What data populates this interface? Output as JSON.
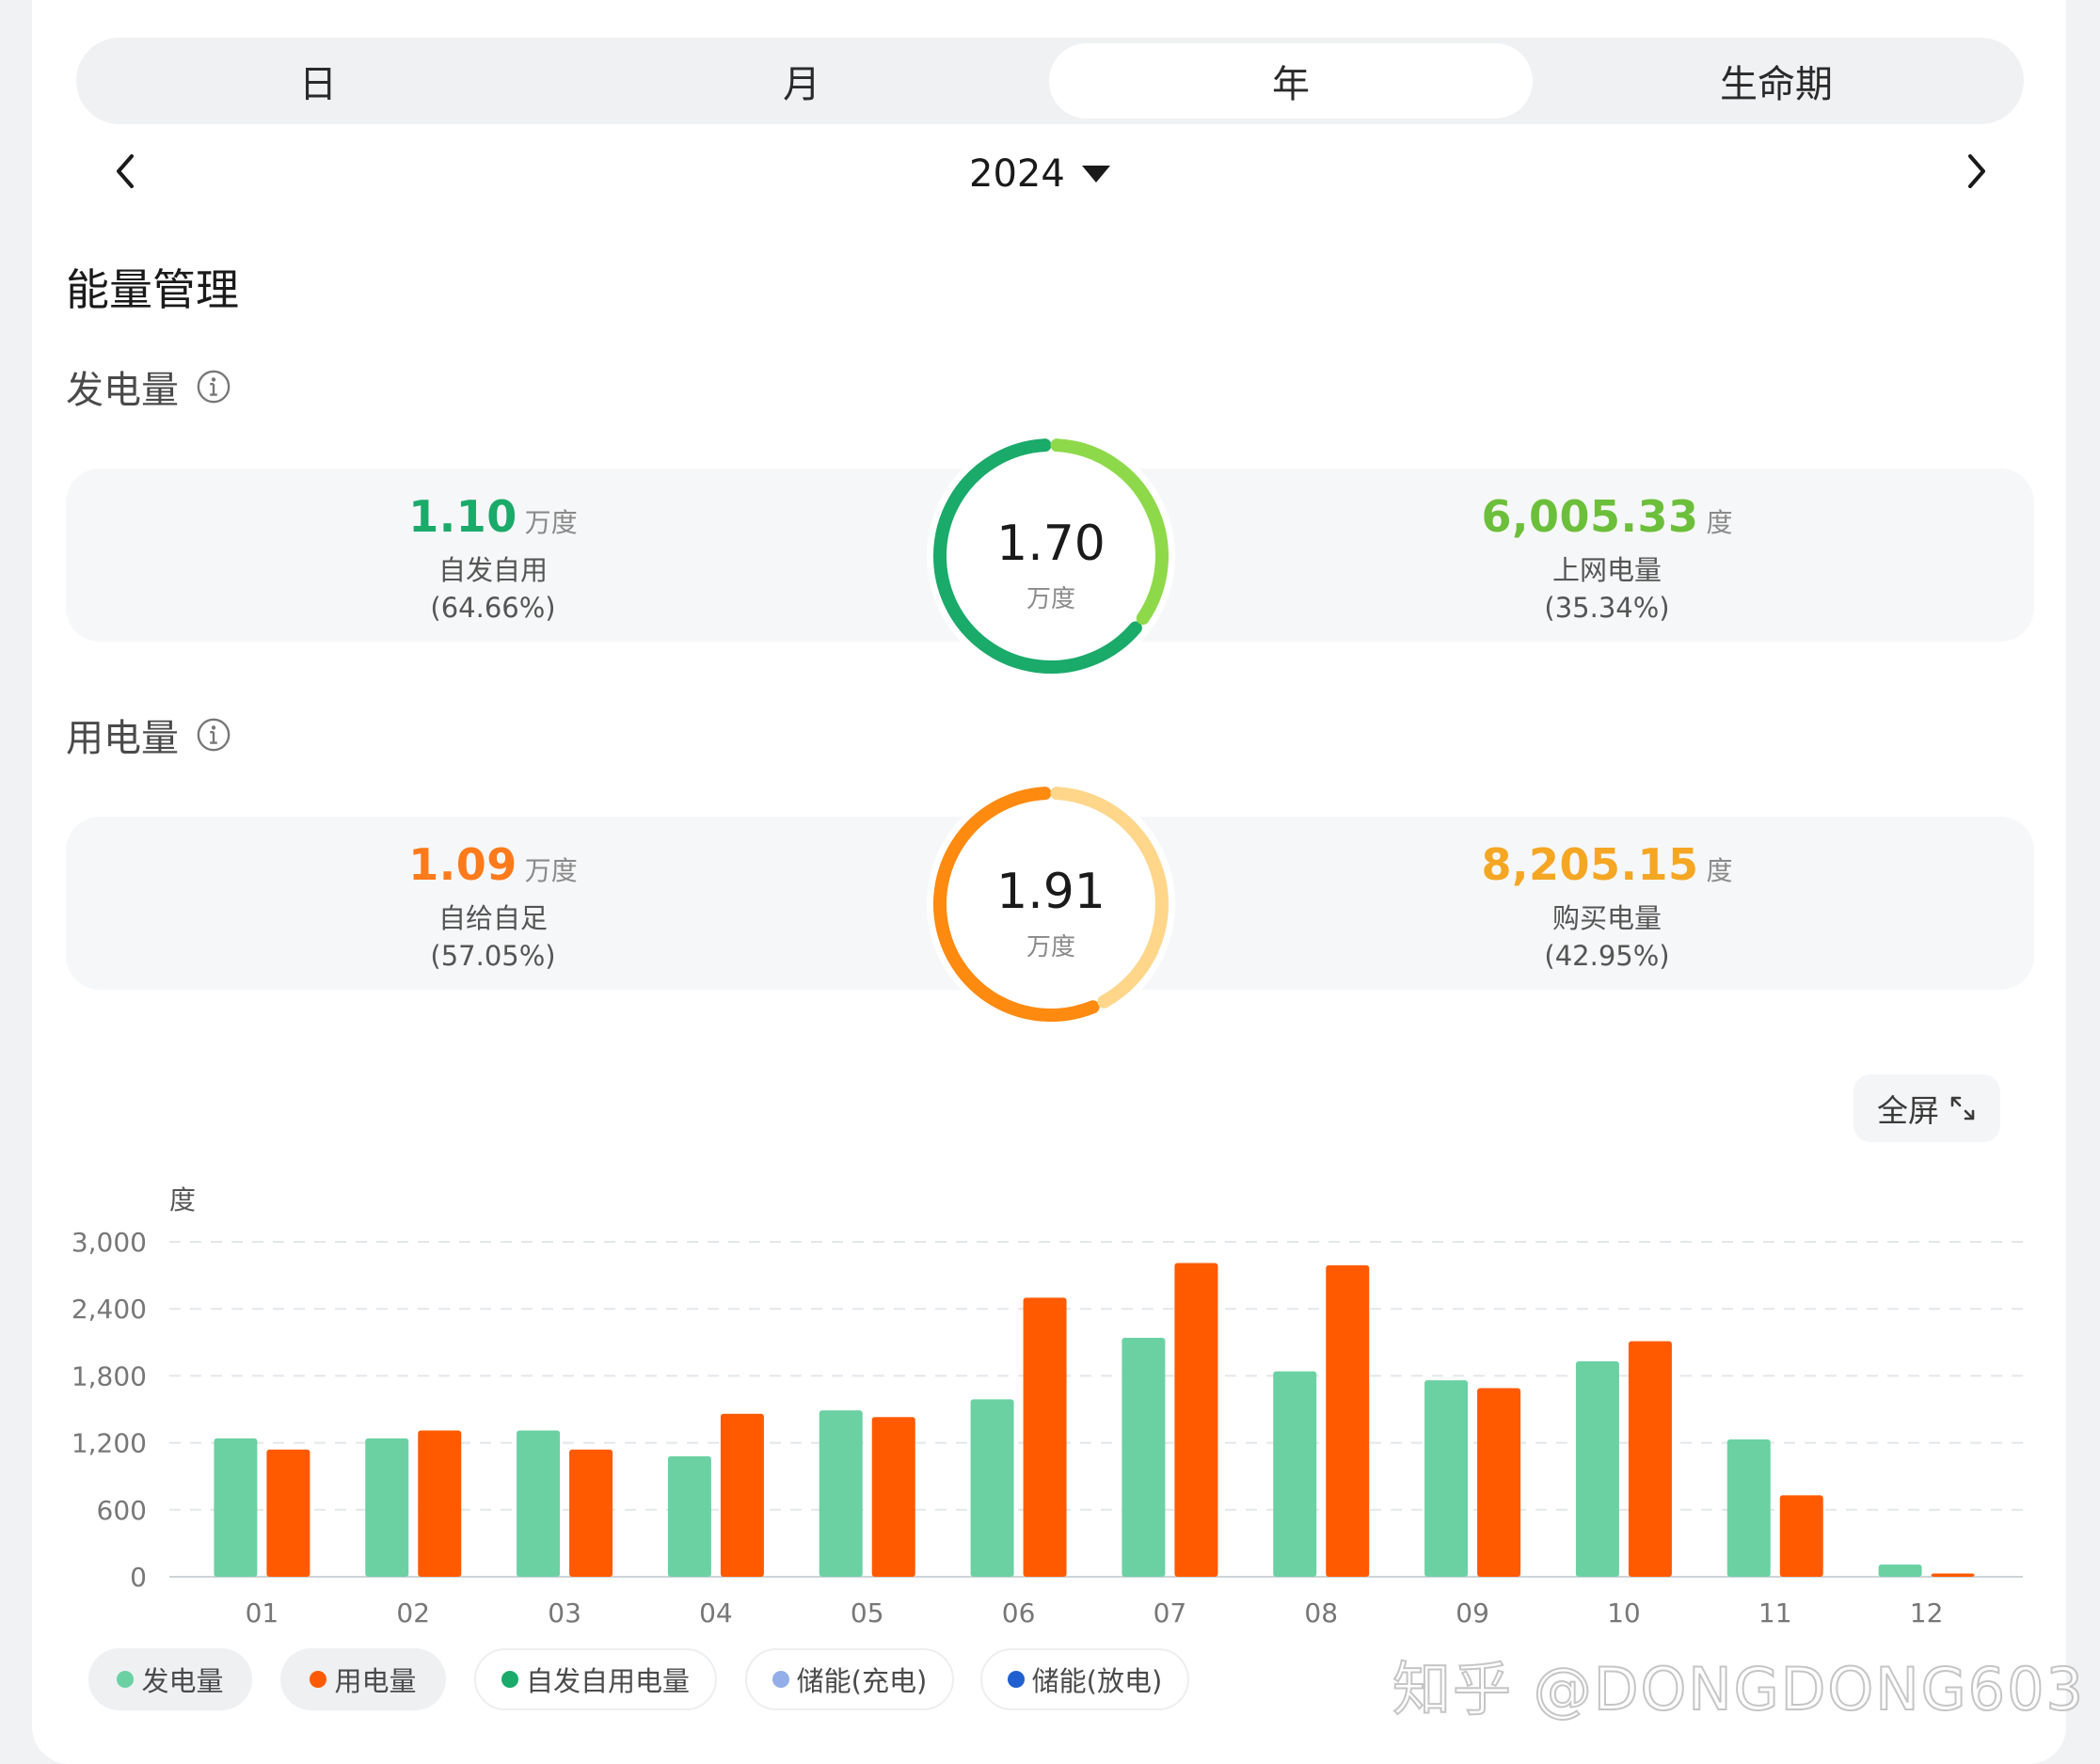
{
  "tabs": [
    {
      "label": "日",
      "active": false
    },
    {
      "label": "月",
      "active": false
    },
    {
      "label": "年",
      "active": true
    },
    {
      "label": "生命期",
      "active": false
    }
  ],
  "year_nav": {
    "year": "2024"
  },
  "section_title": "能量管理",
  "generation": {
    "heading": "发电量",
    "left": {
      "value": "1.10",
      "unit": "万度",
      "label": "自发自用",
      "pct": "(64.66%)",
      "color": "#1aaa6a"
    },
    "ring": {
      "value": "1.70",
      "unit": "万度",
      "share": 0.6466,
      "color_main": "#1aaa6a",
      "color_rest": "#8ed94a"
    },
    "right": {
      "value": "6,005.33",
      "unit": "度",
      "label": "上网电量",
      "pct": "(35.34%)",
      "color": "#6cbf3a"
    }
  },
  "consumption": {
    "heading": "用电量",
    "left": {
      "value": "1.09",
      "unit": "万度",
      "label": "自给自足",
      "pct": "(57.05%)",
      "color": "#ff7a1a"
    },
    "ring": {
      "value": "1.91",
      "unit": "万度",
      "share": 0.5705,
      "color_main": "#ff8a10",
      "color_rest": "#ffd68a"
    },
    "right": {
      "value": "8,205.15",
      "unit": "度",
      "label": "购买电量",
      "pct": "(42.95%)",
      "color": "#f5a623"
    }
  },
  "fullscreen_label": "全屏",
  "chart_data": {
    "type": "bar",
    "ylabel": "度",
    "ylim": [
      0,
      3000
    ],
    "yticks": [
      0,
      600,
      1200,
      1800,
      2400,
      3000
    ],
    "ytick_labels": [
      "0",
      "600",
      "1,200",
      "1,800",
      "2,400",
      "3,000"
    ],
    "categories": [
      "01",
      "02",
      "03",
      "04",
      "05",
      "06",
      "07",
      "08",
      "09",
      "10",
      "11",
      "12"
    ],
    "grid": true,
    "series": [
      {
        "name": "发电量",
        "color": "#6bd1a3",
        "values": [
          1240,
          1240,
          1310,
          1080,
          1490,
          1590,
          2140,
          1840,
          1760,
          1930,
          1230,
          110
        ]
      },
      {
        "name": "用电量",
        "color": "#ff5a00",
        "values": [
          1140,
          1310,
          1140,
          1460,
          1430,
          2500,
          2810,
          2790,
          1690,
          2110,
          730,
          30
        ]
      }
    ]
  },
  "legend": [
    {
      "name": "发电量",
      "color": "#6bd1a3",
      "on": true
    },
    {
      "name": "用电量",
      "color": "#ff5a00",
      "on": true
    },
    {
      "name": "自发自用电量",
      "color": "#1aaa6a",
      "on": false
    },
    {
      "name": "储能(充电)",
      "color": "#93aee8",
      "on": false
    },
    {
      "name": "储能(放电)",
      "color": "#1f5fd0",
      "on": false
    }
  ],
  "watermark": "知乎 @DONGDONG603"
}
